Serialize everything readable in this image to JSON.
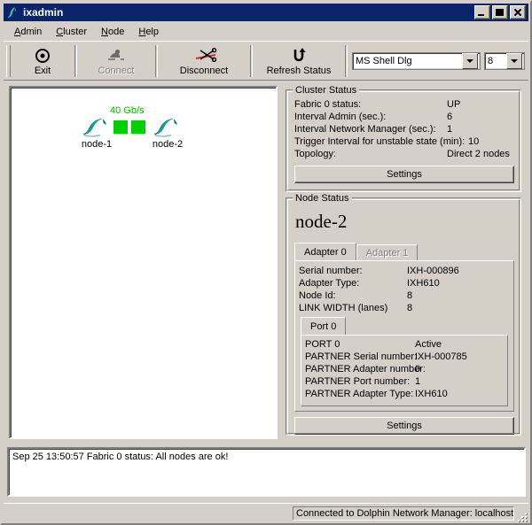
{
  "window": {
    "title": "ixadmin",
    "icon": "dolphin-icon",
    "buttons": {
      "minimize": "–",
      "maximize": "□",
      "close": "✕"
    }
  },
  "menubar": {
    "items": [
      {
        "label": "Admin",
        "mnemonic": "A"
      },
      {
        "label": "Cluster",
        "mnemonic": "C"
      },
      {
        "label": "Node",
        "mnemonic": "N"
      },
      {
        "label": "Help",
        "mnemonic": "H"
      }
    ]
  },
  "toolbar": {
    "buttons": [
      {
        "label": "Exit",
        "icon": "exit-icon",
        "enabled": true
      },
      {
        "label": "Connect",
        "icon": "connect-icon",
        "enabled": false
      },
      {
        "label": "Disconnect",
        "icon": "disconnect-scissors-icon",
        "enabled": true
      },
      {
        "label": "Refresh Status",
        "icon": "refresh-icon",
        "enabled": true
      }
    ],
    "font_combo": {
      "value": "MS Shell Dlg",
      "name": "font-family-combo"
    },
    "size_combo": {
      "value": "8",
      "name": "font-size-combo"
    }
  },
  "canvas": {
    "topology": {
      "speed_label": "40  Gb/s",
      "speed_color": "#00c000",
      "link_color": "#00d000",
      "nodes": [
        {
          "label": "node-1",
          "icon": "dolphin-node-icon"
        },
        {
          "label": "node-2",
          "icon": "dolphin-node-icon"
        }
      ]
    }
  },
  "cluster_status": {
    "group_title": "Cluster Status",
    "rows": [
      {
        "key": "Fabric 0 status:",
        "value": "UP"
      },
      {
        "key": "Interval Admin (sec.):",
        "value": "6"
      },
      {
        "key": "Interval Network Manager (sec.):",
        "value": "1"
      },
      {
        "key": "Trigger Interval for unstable state (min):",
        "value": "10"
      },
      {
        "key": "Topology:",
        "value": "Direct 2 nodes"
      }
    ],
    "settings_button": "Settings"
  },
  "node_status": {
    "group_title": "Node Status",
    "node_name": "node-2",
    "adapter_tabs": [
      {
        "label": "Adapter 0",
        "selected": true,
        "enabled": true
      },
      {
        "label": "Adapter 1",
        "selected": false,
        "enabled": false
      }
    ],
    "adapter_rows": [
      {
        "key": "Serial number:",
        "value": "IXH-000896"
      },
      {
        "key": "Adapter Type:",
        "value": "IXH610"
      },
      {
        "key": "Node Id:",
        "value": "8"
      },
      {
        "key": "LINK WIDTH (lanes)",
        "value": "8"
      }
    ],
    "port_tabs": [
      {
        "label": "Port 0",
        "selected": true,
        "enabled": true
      }
    ],
    "port_rows": [
      {
        "key": "PORT 0",
        "value": "Active"
      },
      {
        "key": "PARTNER Serial number:",
        "value": "IXH-000785"
      },
      {
        "key": "PARTNER Adapter number:",
        "value": "0"
      },
      {
        "key": "PARTNER Port number:",
        "value": "1"
      },
      {
        "key": "PARTNER Adapter Type:",
        "value": "IXH610"
      }
    ],
    "settings_button": "Settings"
  },
  "log": {
    "lines": [
      "Sep 25 13:50:57 Fabric 0 status: All nodes are ok!"
    ]
  },
  "statusbar": {
    "left": "",
    "right": "Connected to Dolphin Network Manager: localhost"
  }
}
